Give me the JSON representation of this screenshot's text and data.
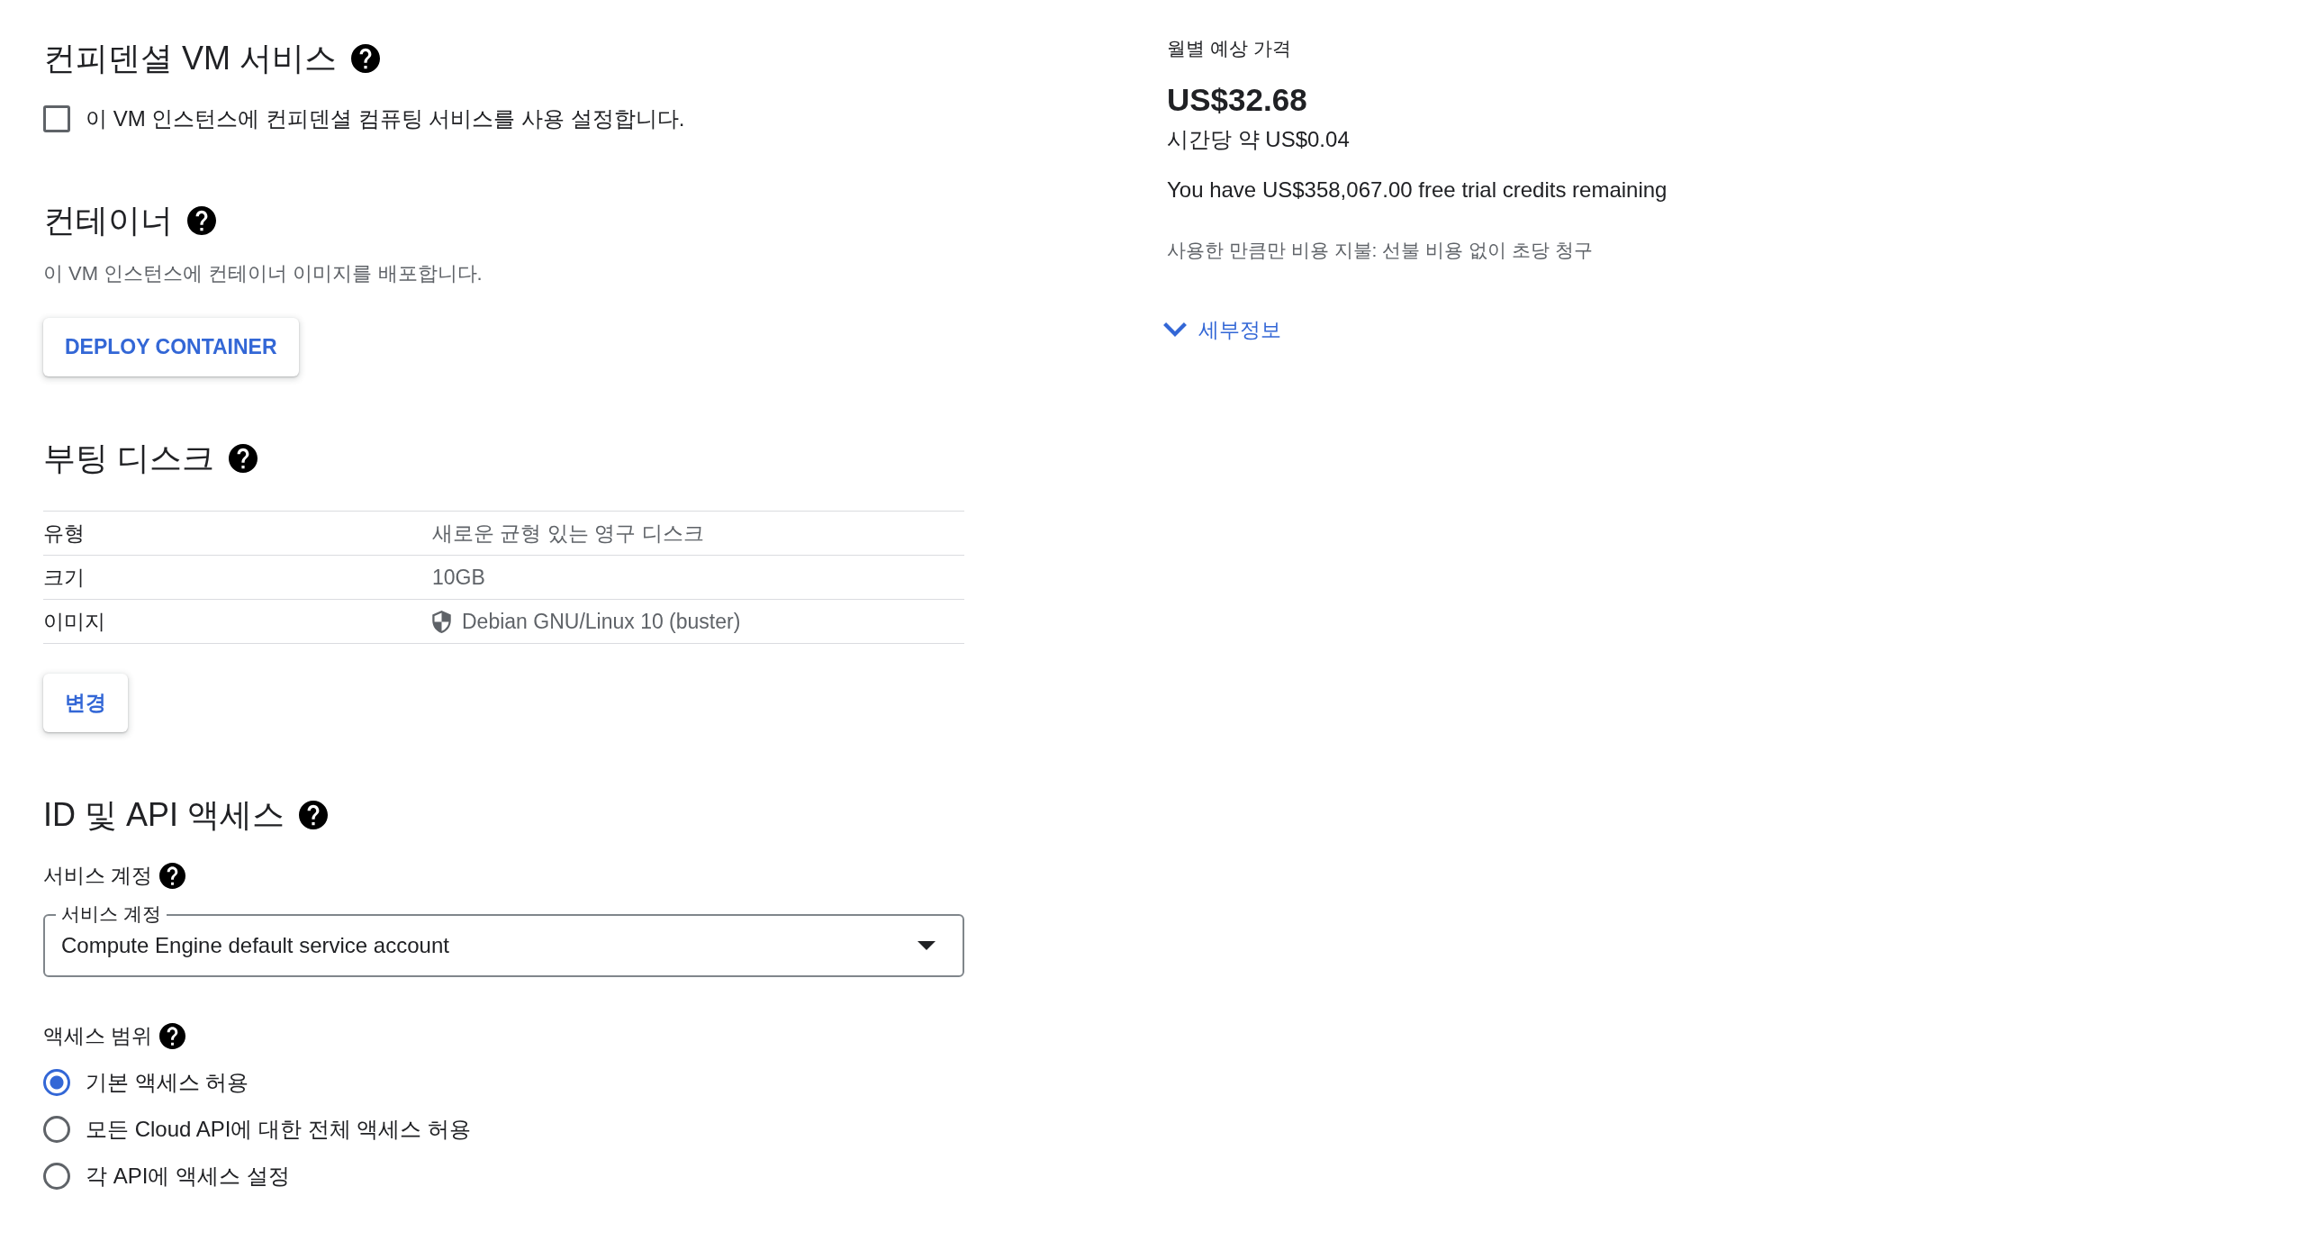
{
  "confidential_vm": {
    "title": "컨피덴셜 VM 서비스",
    "checkbox": {
      "label": "이 VM 인스턴스에 컨피덴셜 컴퓨팅 서비스를 사용 설정합니다.",
      "checked": false
    }
  },
  "container": {
    "title": "컨테이너",
    "description": "이 VM 인스턴스에 컨테이너 이미지를 배포합니다.",
    "button": "DEPLOY CONTAINER"
  },
  "boot_disk": {
    "title": "부팅 디스크",
    "rows": [
      {
        "kind": "text",
        "label": "유형",
        "value": "새로운 균형 있는 영구 디스크"
      },
      {
        "kind": "text",
        "label": "크기",
        "value": "10GB"
      },
      {
        "kind": "image",
        "label": "이미지",
        "value": "Debian GNU/Linux 10 (buster)"
      }
    ],
    "button": "변경"
  },
  "identity_api": {
    "title": "ID 및 API 액세스",
    "service_account": {
      "label": "서비스 계정",
      "field_label": "서비스 계정",
      "value": "Compute Engine default service account"
    },
    "access_scope": {
      "label": "액세스 범위",
      "options": [
        {
          "label": "기본 액세스 허용",
          "selected": true
        },
        {
          "label": "모든 Cloud API에 대한 전체 액세스 허용",
          "selected": false
        },
        {
          "label": "각 API에 액세스 설정",
          "selected": false
        }
      ]
    }
  },
  "pricing": {
    "title": "월별 예상 가격",
    "monthly": "US$32.68",
    "hourly": "시간당 약 US$0.04",
    "credits": "You have US$358,067.00 free trial credits remaining",
    "note": "사용한 만큼만 비용 지불: 선불 비용 없이 초당 청구",
    "details": {
      "label": "세부정보",
      "expanded": false
    }
  }
}
